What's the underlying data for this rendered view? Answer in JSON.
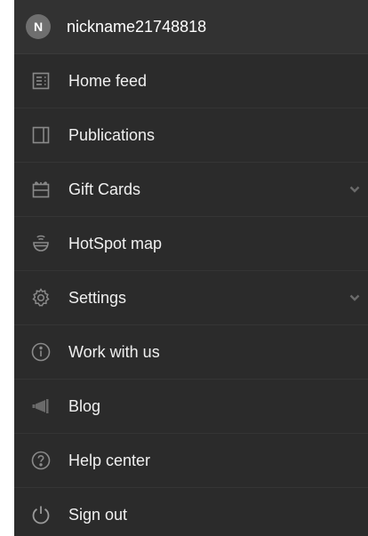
{
  "user": {
    "avatar_initial": "N",
    "nickname": "nickname21748818"
  },
  "menu": {
    "items": [
      {
        "label": "Home feed",
        "icon": "home-feed-icon"
      },
      {
        "label": "Publications",
        "icon": "publications-icon"
      },
      {
        "label": "Gift Cards",
        "icon": "gift-card-icon",
        "expandable": true
      },
      {
        "label": "HotSpot map",
        "icon": "coffee-cup-icon"
      },
      {
        "label": "Settings",
        "icon": "gear-icon",
        "expandable": true
      },
      {
        "label": "Work with us",
        "icon": "info-icon"
      },
      {
        "label": "Blog",
        "icon": "megaphone-icon"
      },
      {
        "label": "Help center",
        "icon": "question-icon"
      },
      {
        "label": "Sign out",
        "icon": "power-icon"
      }
    ]
  },
  "colors": {
    "drawer_bg": "#2b2b2b",
    "header_bg": "#323232",
    "icon": "#8a8a8a",
    "text": "#f0f0f0",
    "divider": "#353535"
  }
}
